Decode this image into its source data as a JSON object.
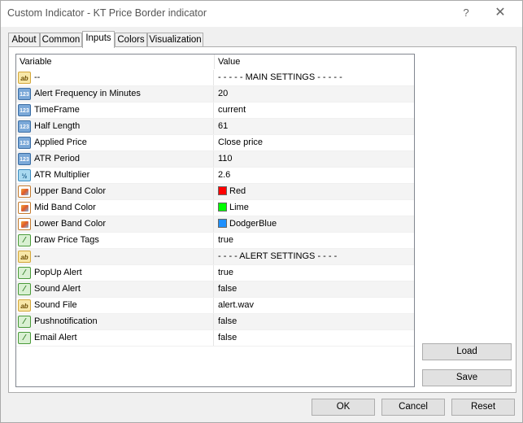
{
  "window": {
    "title": "Custom Indicator - KT Price Border indicator",
    "help": "?",
    "close": "✕"
  },
  "tabs": [
    {
      "label": "About"
    },
    {
      "label": "Common"
    },
    {
      "label": "Inputs"
    },
    {
      "label": "Colors"
    },
    {
      "label": "Visualization"
    }
  ],
  "active_tab": "Inputs",
  "grid": {
    "col_variable": "Variable",
    "col_value": "Value",
    "rows": [
      {
        "icon": "ab",
        "icon_text": "ab",
        "name": "--",
        "value": "- - - - - MAIN SETTINGS - - - - -"
      },
      {
        "icon": "num",
        "icon_text": "123",
        "name": "Alert Frequency in Minutes",
        "value": "20"
      },
      {
        "icon": "num",
        "icon_text": "123",
        "name": "TimeFrame",
        "value": "current"
      },
      {
        "icon": "num",
        "icon_text": "123",
        "name": "Half Length",
        "value": "61"
      },
      {
        "icon": "num",
        "icon_text": "123",
        "name": "Applied Price",
        "value": "Close price"
      },
      {
        "icon": "num",
        "icon_text": "123",
        "name": "ATR Period",
        "value": "110"
      },
      {
        "icon": "dbl",
        "icon_text": "½",
        "name": "ATR Multiplier",
        "value": "2.6"
      },
      {
        "icon": "clr",
        "icon_text": "",
        "name": "Upper Band Color",
        "value": "Red",
        "swatch": "#ff0000"
      },
      {
        "icon": "clr",
        "icon_text": "",
        "name": "Mid Band Color",
        "value": "Lime",
        "swatch": "#00ff00"
      },
      {
        "icon": "clr",
        "icon_text": "",
        "name": "Lower Band Color",
        "value": "DodgerBlue",
        "swatch": "#1e90ff"
      },
      {
        "icon": "bool",
        "icon_text": "⁄",
        "name": "Draw Price Tags",
        "value": "true"
      },
      {
        "icon": "ab",
        "icon_text": "ab",
        "name": "--",
        "value": "- - - - ALERT SETTINGS - - - -"
      },
      {
        "icon": "bool",
        "icon_text": "⁄",
        "name": "PopUp Alert",
        "value": "true"
      },
      {
        "icon": "bool",
        "icon_text": "⁄",
        "name": "Sound Alert",
        "value": "false"
      },
      {
        "icon": "ab",
        "icon_text": "ab",
        "name": "Sound File",
        "value": "alert.wav"
      },
      {
        "icon": "bool",
        "icon_text": "⁄",
        "name": "Pushnotification",
        "value": "false"
      },
      {
        "icon": "bool",
        "icon_text": "⁄",
        "name": "Email Alert",
        "value": "false"
      }
    ]
  },
  "buttons": {
    "load": "Load",
    "save": "Save",
    "ok": "OK",
    "cancel": "Cancel",
    "reset": "Reset"
  }
}
